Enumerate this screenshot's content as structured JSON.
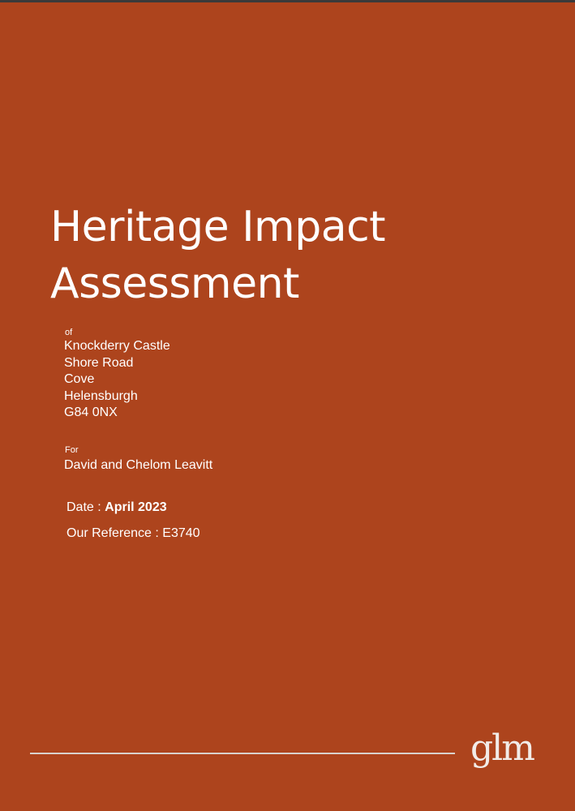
{
  "cover": {
    "title_line1": "Heritage Impact",
    "title_line2": "Assessment",
    "of_label": "of",
    "address": [
      "Knockderry Castle",
      "Shore Road",
      "Cove",
      "Helensburgh",
      "G84 0NX"
    ],
    "for_label": "For",
    "client": "David and Chelom Leavitt",
    "date_label": "Date : ",
    "date_value": "April 2023",
    "reference_label": "Our Reference : ",
    "reference_value": "E3740",
    "logo_text": "glm"
  },
  "colors": {
    "background": "#ad441d",
    "text": "#ffffff",
    "rule": "#d9d2cd"
  }
}
